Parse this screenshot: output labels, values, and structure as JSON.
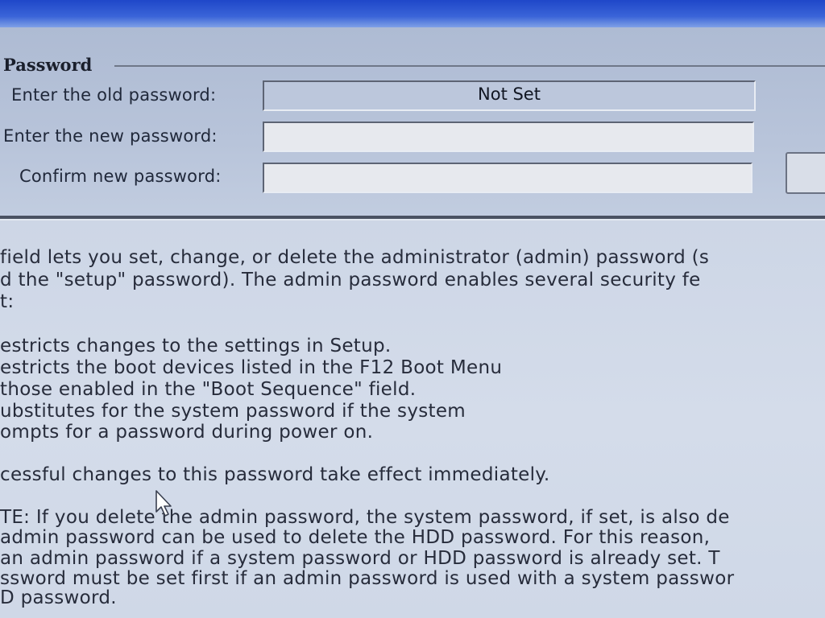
{
  "group": {
    "title": "Password"
  },
  "fields": [
    {
      "label": "Enter the old password:",
      "value": "Not Set"
    },
    {
      "label": "Enter the new password:",
      "value": ""
    },
    {
      "label": "Confirm new password:",
      "value": ""
    }
  ],
  "help": {
    "lines": [
      "field lets you set, change, or delete the administrator (admin) password (s",
      "d the \"setup\" password).  The admin password enables several security fe",
      "t:",
      "estricts changes to the settings in Setup.",
      "estricts the boot devices listed in the F12 Boot Menu",
      "those enabled in the \"Boot Sequence\" field.",
      "ubstitutes for the system password if the system",
      "ompts for a password during power on.",
      "cessful changes to this password take effect immediately.",
      "TE: If you delete the admin password, the system password, if set, is also de",
      " admin password can be used to delete the HDD password.  For this reason,",
      " an admin password if a system password or HDD password is already set.  T",
      "ssword must be set first if an admin password is used with a system passwor",
      "D password."
    ]
  },
  "colors": {
    "title_bar": "#1f47c9",
    "panel_bg": "#b8c4da",
    "help_bg": "#d4dcea"
  }
}
